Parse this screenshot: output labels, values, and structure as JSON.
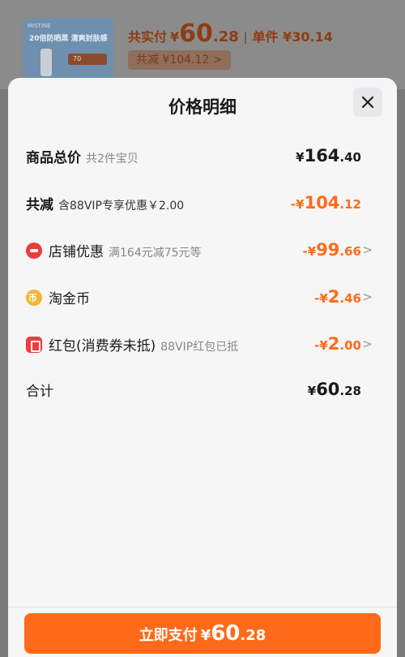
{
  "background": {
    "product_thumb": {
      "brand": "MISTINE",
      "headline": "20倍防晒黑 清爽封肤感",
      "tag": "70"
    },
    "pay_label": "共实付",
    "yen": "¥",
    "pay_int": "60",
    "pay_dec": ".28",
    "unit_label": "单件 ¥30.14",
    "reduce_label": "共减 ¥104.12 >"
  },
  "sheet": {
    "title": "价格明细",
    "rows": [
      {
        "label": "商品总价",
        "sub": "共2件宝贝",
        "yen": "¥",
        "int": "164",
        "dec": ".40"
      },
      {
        "label": "共减",
        "sub": "含88VIP专享优惠￥2.00",
        "yen": "-¥",
        "int": "104",
        "dec": ".12"
      },
      {
        "label": "店铺优惠",
        "sub": "满164元减75元等",
        "yen": "-¥",
        "int": "99",
        "dec": ".66",
        "icon": "shop-coupon-icon"
      },
      {
        "label": "淘金币",
        "sub": "",
        "yen": "-¥",
        "int": "2",
        "dec": ".46",
        "icon": "taojinbi-coin-icon"
      },
      {
        "label": "红包(消费券未抵)",
        "sub": "88VIP红包已抵",
        "yen": "-¥",
        "int": "2",
        "dec": ".00",
        "icon": "red-packet-icon"
      },
      {
        "label": "合计",
        "sub": "",
        "yen": "¥",
        "int": "60",
        "dec": ".28"
      }
    ],
    "chevron": ">"
  },
  "pay_button": {
    "label": "立即支付",
    "yen": "¥",
    "int": "60",
    "dec": ".28"
  },
  "colors": {
    "accent": "#ff6a1a",
    "text": "#1a1a1a",
    "muted": "#888888"
  }
}
